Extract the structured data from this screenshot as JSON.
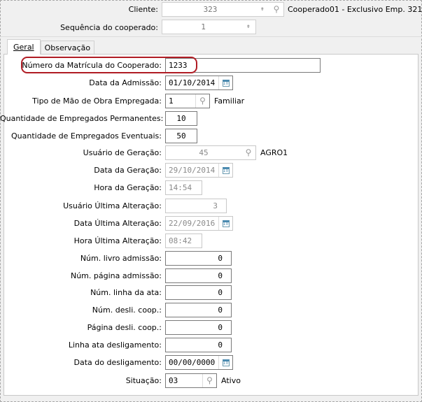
{
  "header": {
    "cliente": {
      "label": "Cliente:",
      "value": "323",
      "description": "Cooperado01 - Exclusivo Emp. 321"
    },
    "sequencia": {
      "label": "Sequência do cooperado:",
      "value": "1"
    }
  },
  "tabs": [
    {
      "label": "Geral",
      "active": true
    },
    {
      "label": "Observação",
      "active": false
    }
  ],
  "highlight_color": "#b01c24",
  "fields": [
    {
      "label": "Número da Matrícula do Cooperado:",
      "value": "1233"
    },
    {
      "label": "Data da Admissão:",
      "value": "01/10/2014"
    },
    {
      "label": "Tipo de Mão de Obra Empregada:",
      "value": "1",
      "extra": "Familiar"
    },
    {
      "label": "Quantidade de Empregados Permanentes:",
      "value": "10"
    },
    {
      "label": "Quantidade de Empregados Eventuais:",
      "value": "50"
    },
    {
      "label": "Usuário de Geração:",
      "value": "45",
      "extra": "AGRO1"
    },
    {
      "label": "Data da Geração:",
      "value": "29/10/2014"
    },
    {
      "label": "Hora da Geração:",
      "value": "14:54"
    },
    {
      "label": "Usuário Última Alteração:",
      "value": "3"
    },
    {
      "label": "Data Última Alteração:",
      "value": "22/09/2016"
    },
    {
      "label": "Hora Última Alteração:",
      "value": "08:42"
    },
    {
      "label": "Núm. livro admissão:",
      "value": "0"
    },
    {
      "label": "Núm. página admissão:",
      "value": "0"
    },
    {
      "label": "Núm. linha da ata:",
      "value": "0"
    },
    {
      "label": "Núm. desli. coop.:",
      "value": "0"
    },
    {
      "label": "Página desli. coop.:",
      "value": "0"
    },
    {
      "label": "Linha ata desligamento:",
      "value": "0"
    },
    {
      "label": "Data do desligamento:",
      "value": "00/00/0000"
    },
    {
      "label": "Situação:",
      "value": "03",
      "extra": "Ativo"
    }
  ]
}
